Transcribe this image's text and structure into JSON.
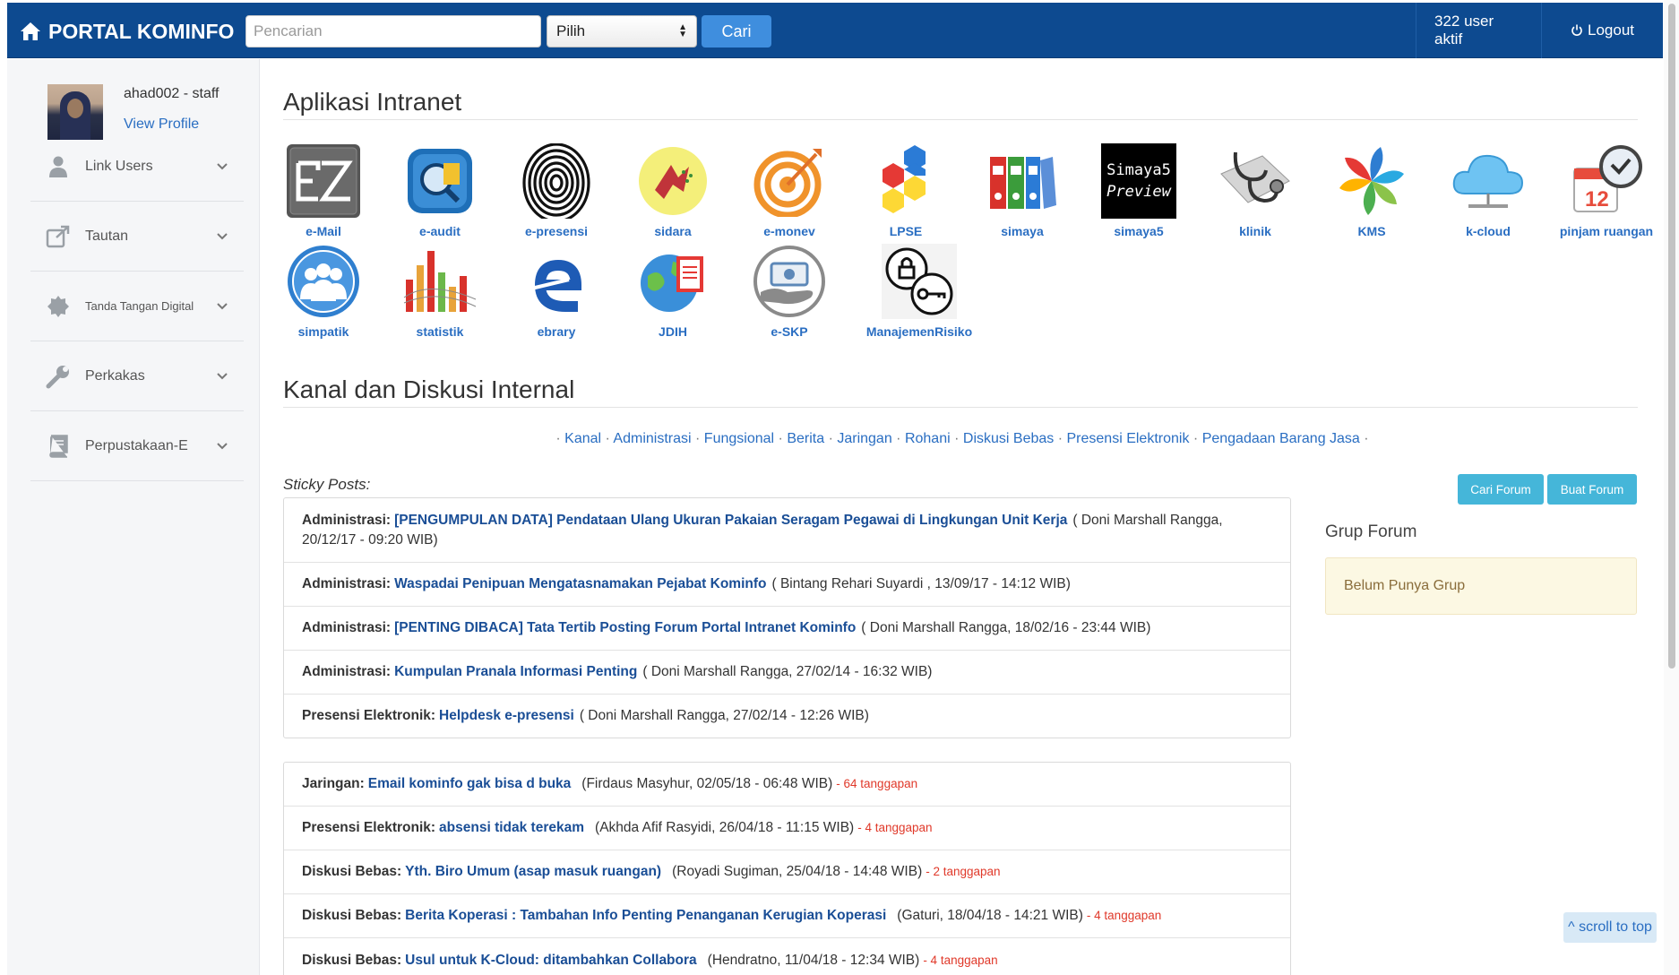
{
  "navbar": {
    "brand": "PORTAL KOMINFO",
    "search_placeholder": "Pencarian",
    "select_value": "Pilih",
    "search_button": "Cari",
    "active_users": "322 user aktif",
    "logout": "Logout"
  },
  "sidebar": {
    "username": "ahad002 - staff",
    "view_profile": "View Profile",
    "menu": [
      {
        "label": "Link Users",
        "icon": "user-icon"
      },
      {
        "label": "Tautan",
        "icon": "external-link-icon"
      },
      {
        "label": "Tanda Tangan Digital",
        "icon": "certificate-icon"
      },
      {
        "label": "Perkakas",
        "icon": "wrench-icon"
      },
      {
        "label": "Perpustakaan-E",
        "icon": "book-icon"
      }
    ]
  },
  "apps_section": {
    "title": "Aplikasi Intranet",
    "apps": [
      {
        "label": "e-Mail",
        "icon": "ez-mail-icon"
      },
      {
        "label": "e-audit",
        "icon": "e-audit-icon"
      },
      {
        "label": "e-presensi",
        "icon": "fingerprint-icon"
      },
      {
        "label": "sidara",
        "icon": "sidara-icon"
      },
      {
        "label": "e-monev",
        "icon": "target-icon"
      },
      {
        "label": "LPSE",
        "icon": "hexagons-icon"
      },
      {
        "label": "simaya",
        "icon": "binders-icon"
      },
      {
        "label": "simaya5",
        "icon": "simaya5-preview-icon"
      },
      {
        "label": "klinik",
        "icon": "stethoscope-icon"
      },
      {
        "label": "KMS",
        "icon": "pinwheel-icon"
      },
      {
        "label": "k-cloud",
        "icon": "cloud-icon"
      },
      {
        "label": "pinjam ruangan",
        "icon": "calendar-clock-icon"
      },
      {
        "label": "simpatik",
        "icon": "people-icon"
      },
      {
        "label": "statistik",
        "icon": "bar-chart-icon"
      },
      {
        "label": "ebrary",
        "icon": "ebrary-icon"
      },
      {
        "label": "JDIH",
        "icon": "globe-book-icon"
      },
      {
        "label": "e-SKP",
        "icon": "hand-money-icon"
      },
      {
        "label": "ManajemenRisiko",
        "icon": "risk-key-icon"
      }
    ],
    "simaya5_icon_text": [
      "Simaya5",
      "Preview"
    ]
  },
  "kanal_section": {
    "title": "Kanal dan Diskusi Internal",
    "links": [
      "Kanal",
      "Administrasi",
      "Fungsional",
      "Berita",
      "Jaringan",
      "Rohani",
      "Diskusi Bebas",
      "Presensi Elektronik",
      "Pengadaan Barang Jasa"
    ],
    "separator": "·"
  },
  "forum": {
    "sticky_label": "Sticky Posts:",
    "cari_forum": "Cari Forum",
    "buat_forum": "Buat Forum",
    "grup_title": "Grup Forum",
    "grup_empty": "Belum Punya Grup",
    "sticky_posts": [
      {
        "category": "Administrasi:",
        "title": "[PENGUMPULAN DATA] Pendataan Ulang Ukuran Pakaian Seragam Pegawai di Lingkungan Unit Kerja",
        "meta": "( Doni Marshall Rangga, 20/12/17 - 09:20 WIB)"
      },
      {
        "category": "Administrasi:",
        "title": "Waspadai Penipuan Mengatasnamakan Pejabat Kominfo",
        "meta": "( Bintang Rehari Suyardi , 13/09/17 - 14:12 WIB)"
      },
      {
        "category": "Administrasi:",
        "title": "[PENTING DIBACA] Tata Tertib Posting Forum Portal Intranet Kominfo",
        "meta": "( Doni Marshall Rangga, 18/02/16 - 23:44 WIB)"
      },
      {
        "category": "Administrasi:",
        "title": "Kumpulan Pranala Informasi Penting",
        "meta": "( Doni Marshall Rangga, 27/02/14 - 16:32 WIB)"
      },
      {
        "category": "Presensi Elektronik:",
        "title": "Helpdesk e-presensi",
        "meta": "( Doni Marshall Rangga, 27/02/14 - 12:26 WIB)"
      }
    ],
    "recent_posts": [
      {
        "category": "Jaringan:",
        "title": "Email kominfo gak bisa d buka",
        "meta": "(Firdaus Masyhur, 02/05/18 - 06:48 WIB)",
        "responses": "- 64 tanggapan"
      },
      {
        "category": "Presensi Elektronik:",
        "title": "absensi tidak terekam",
        "meta": "(Akhda Afif Rasyidi, 26/04/18 - 11:15 WIB)",
        "responses": "- 4 tanggapan"
      },
      {
        "category": "Diskusi Bebas:",
        "title": "Yth. Biro Umum (asap masuk ruangan)",
        "meta": "(Royadi Sugiman, 25/04/18 - 14:48 WIB)",
        "responses": "- 2 tanggapan"
      },
      {
        "category": "Diskusi Bebas:",
        "title": "Berita Koperasi : Tambahan Info Penting Penanganan Kerugian Koperasi",
        "meta": "(Gaturi, 18/04/18 - 14:21 WIB)",
        "responses": "- 4 tanggapan"
      },
      {
        "category": "Diskusi Bebas:",
        "title": "Usul untuk K-Cloud: ditambahkan Collabora",
        "meta": "(Hendratno, 11/04/18 - 12:34 WIB)",
        "responses": "- 4 tanggapan"
      }
    ]
  },
  "scroll_top": "^ scroll to top",
  "colors": {
    "navbar": "#0d4a90",
    "link": "#2a6ec2",
    "post_title": "#1a4e96",
    "response": "#e0392a",
    "info_button": "#45b6d9"
  }
}
